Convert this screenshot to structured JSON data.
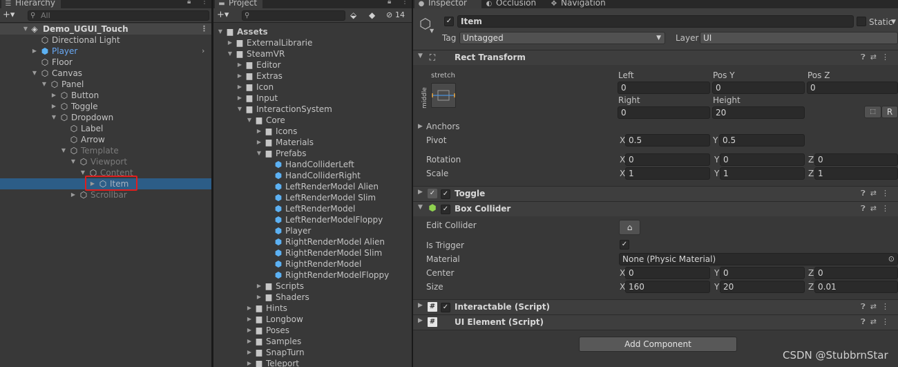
{
  "hierarchy": {
    "tab": "Hierarchy",
    "add": "+▾",
    "search_placeholder": "All",
    "scene": "Demo_UGUI_Touch",
    "items": [
      {
        "label": "Directional Light"
      },
      {
        "label": "Player"
      },
      {
        "label": "Floor"
      },
      {
        "label": "Canvas"
      },
      {
        "label": "Panel"
      },
      {
        "label": "Button"
      },
      {
        "label": "Toggle"
      },
      {
        "label": "Dropdown"
      },
      {
        "label": "Label"
      },
      {
        "label": "Arrow"
      },
      {
        "label": "Template"
      },
      {
        "label": "Viewport"
      },
      {
        "label": "Content"
      },
      {
        "label": "Item"
      },
      {
        "label": "Scrollbar"
      }
    ]
  },
  "project": {
    "tab": "Project",
    "add": "+▾",
    "search_placeholder": "",
    "hidden_count": "14",
    "items": [
      {
        "label": "Assets"
      },
      {
        "label": "ExternalLibrarie"
      },
      {
        "label": "SteamVR"
      },
      {
        "label": "Editor"
      },
      {
        "label": "Extras"
      },
      {
        "label": "Icon"
      },
      {
        "label": "Input"
      },
      {
        "label": "InteractionSystem"
      },
      {
        "label": "Core"
      },
      {
        "label": "Icons"
      },
      {
        "label": "Materials"
      },
      {
        "label": "Prefabs"
      },
      {
        "label": "HandColliderLeft"
      },
      {
        "label": "HandColliderRight"
      },
      {
        "label": "LeftRenderModel Alien"
      },
      {
        "label": "LeftRenderModel Slim"
      },
      {
        "label": "LeftRenderModel"
      },
      {
        "label": "LeftRenderModelFloppy"
      },
      {
        "label": "Player"
      },
      {
        "label": "RightRenderModel Alien"
      },
      {
        "label": "RightRenderModel Slim"
      },
      {
        "label": "RightRenderModel"
      },
      {
        "label": "RightRenderModelFloppy"
      },
      {
        "label": "Scripts"
      },
      {
        "label": "Shaders"
      },
      {
        "label": "Hints"
      },
      {
        "label": "Longbow"
      },
      {
        "label": "Poses"
      },
      {
        "label": "Samples"
      },
      {
        "label": "SnapTurn"
      },
      {
        "label": "Teleport"
      }
    ]
  },
  "inspector": {
    "tabs": [
      "Inspector",
      "Occlusion",
      "Navigation"
    ],
    "object_name": "Item",
    "static_label": "Static",
    "tag_label": "Tag",
    "tag_value": "Untagged",
    "layer_label": "Layer",
    "layer_value": "UI",
    "rect_transform": {
      "title": "Rect Transform",
      "anchor_h": "stretch",
      "anchor_v": "middle",
      "left_label": "Left",
      "left_value": "0",
      "posy_label": "Pos Y",
      "posy_value": "0",
      "posz_label": "Pos Z",
      "posz_value": "0",
      "right_label": "Right",
      "right_value": "0",
      "height_label": "Height",
      "height_value": "20",
      "r_button": "R",
      "anchors_label": "Anchors",
      "pivot_label": "Pivot",
      "pivot_x": "0.5",
      "pivot_y": "0.5",
      "rotation_label": "Rotation",
      "rotation": [
        "0",
        "0",
        "0"
      ],
      "scale_label": "Scale",
      "scale": [
        "1",
        "1",
        "1"
      ]
    },
    "toggle": {
      "title": "Toggle"
    },
    "box_collider": {
      "title": "Box Collider",
      "edit_collider_label": "Edit Collider",
      "is_trigger_label": "Is Trigger",
      "material_label": "Material",
      "material_value": "None (Physic Material)",
      "center_label": "Center",
      "center": [
        "0",
        "0",
        "0"
      ],
      "size_label": "Size",
      "size": [
        "160",
        "20",
        "0.01"
      ]
    },
    "interactable": {
      "title": "Interactable (Script)"
    },
    "ui_element": {
      "title": "UI Element (Script)"
    },
    "add_component": "Add Component",
    "axis_labels": [
      "X",
      "Y",
      "Z"
    ]
  },
  "watermark": "CSDN @StubbrnStar",
  "colors": {
    "selection": "#2c5d87",
    "highlight_box": "#e11d1d",
    "prefab_blue": "#5cb1f3",
    "box_collider_icon": "#8fd14f"
  }
}
